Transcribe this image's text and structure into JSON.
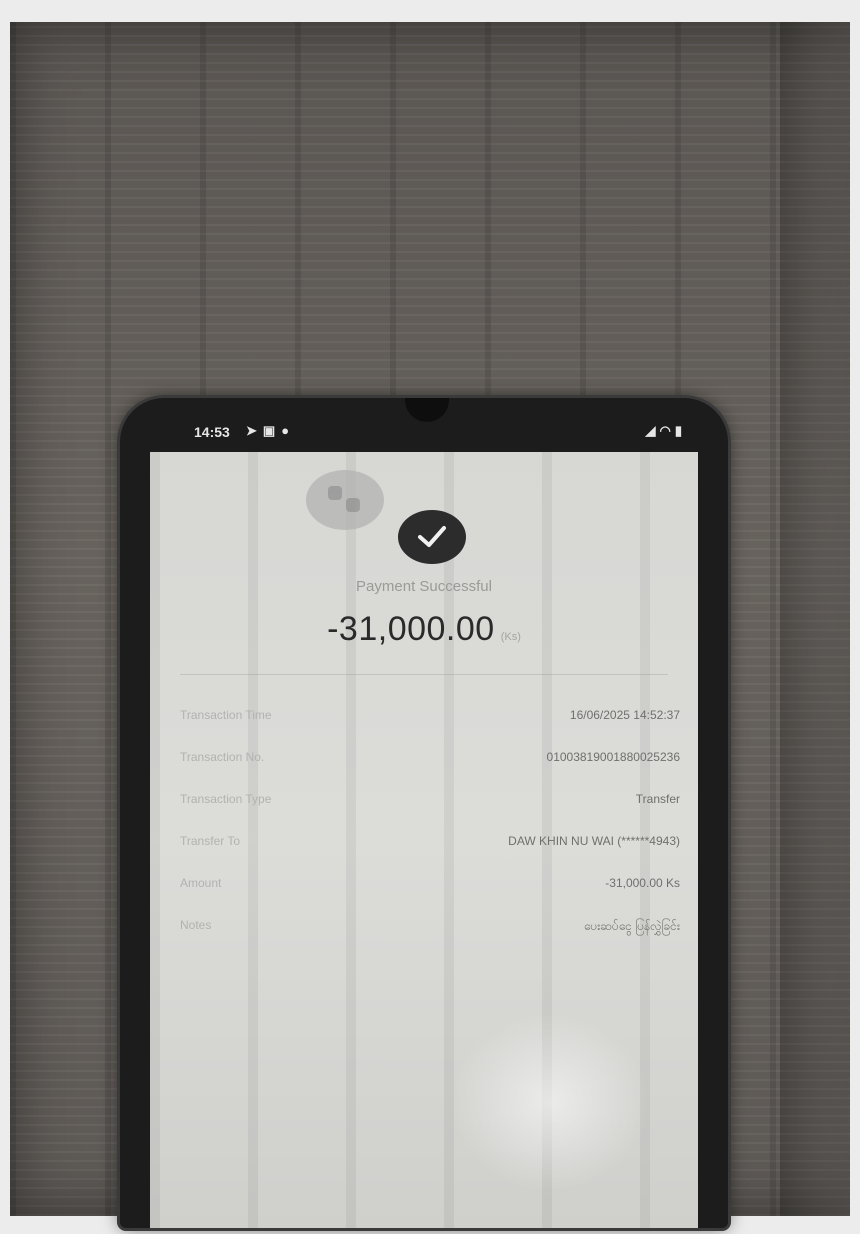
{
  "statusbar": {
    "time": "14:53",
    "left_icons": [
      "location-icon",
      "message-icon",
      "notification-icon"
    ],
    "right_icons": [
      "signal-icon",
      "wifi-icon",
      "battery-icon"
    ]
  },
  "receipt": {
    "status_title": "Payment Successful",
    "amount": "-31,000.00",
    "currency": "(Ks)",
    "details": [
      {
        "label": "Transaction Time",
        "value": "16/06/2025 14:52:37"
      },
      {
        "label": "Transaction No.",
        "value": "01003819001880025236"
      },
      {
        "label": "Transaction Type",
        "value": "Transfer"
      },
      {
        "label": "Transfer To",
        "value": "DAW KHIN NU WAI (******4943)"
      },
      {
        "label": "Amount",
        "value": "-31,000.00 Ks"
      },
      {
        "label": "Notes",
        "value": "ပေးဆပ်ငွေ ပြန်လွှဲခြင်း"
      }
    ]
  },
  "colors": {
    "check_circle": "#2c2c2c",
    "screen_bg": "#d7d7d4",
    "background": "#5e5a56"
  }
}
